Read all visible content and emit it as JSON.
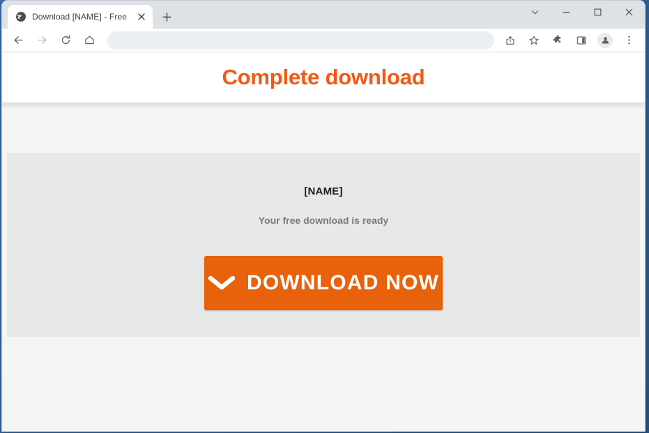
{
  "window": {
    "controls": {
      "tab_search_label": "Search tabs",
      "minimize_label": "Minimize",
      "maximize_label": "Maximize",
      "close_label": "Close"
    }
  },
  "tabstrip": {
    "tabs": [
      {
        "title": "Download [NAME] - Free",
        "favicon": "globe-icon",
        "close_label": "Close tab"
      }
    ],
    "new_tab_label": "New tab"
  },
  "toolbar": {
    "back_label": "Back",
    "forward_label": "Forward",
    "reload_label": "Reload",
    "home_label": "Home",
    "omnibox": {
      "value": "",
      "placeholder": ""
    },
    "share_label": "Share this page",
    "bookmark_label": "Bookmark this tab",
    "extensions_label": "Extensions",
    "side_panel_label": "Side panel",
    "profile_label": "Profile",
    "menu_label": "Customize and control Google Chrome"
  },
  "page": {
    "heading": "Complete download",
    "card": {
      "title": "[NAME]",
      "subtitle": "Your free download is ready",
      "button_label": "DOWNLOAD NOW",
      "button_icon": "chevron-down-icon"
    }
  },
  "colors": {
    "brand_orange": "#f05a14",
    "button_orange": "#e8620c",
    "heading_text": "#f05a14",
    "card_bg": "#e8e8e8",
    "page_bg": "#f5f5f5",
    "subtitle_gray": "#7b7b7b"
  }
}
